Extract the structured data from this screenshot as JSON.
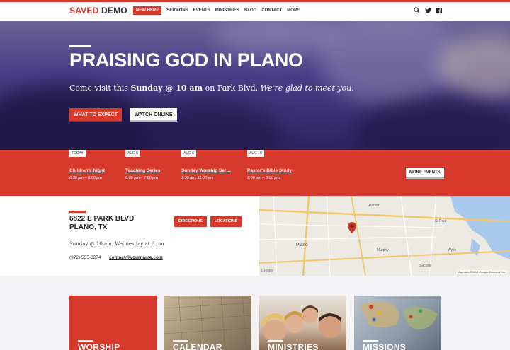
{
  "brand": {
    "part1": "SAVED",
    "part2": "DEMO",
    "accent": "#d7392c"
  },
  "nav": {
    "new_here": "NEW HERE",
    "items": [
      "SERMONS",
      "EVENTS",
      "MINISTRIES",
      "BLOG",
      "CONTACT",
      "MORE"
    ]
  },
  "header_icons": [
    "search-icon",
    "twitter-icon",
    "facebook-icon"
  ],
  "hero": {
    "title": "PRAISING GOD IN PLANO",
    "sub_pre": "Come visit this ",
    "sub_bold": "Sunday @ 10 am",
    "sub_mid": " on Park Blvd. ",
    "sub_italic": "We're glad to meet you.",
    "btn_expect": "WHAT TO EXPECT",
    "btn_watch": "WATCH ONLINE"
  },
  "events": {
    "items": [
      {
        "tag": "TODAY",
        "name": "Children's Night",
        "time": "6:30 pm – 8:00 pm"
      },
      {
        "tag": "AUG 5",
        "name": "Teaching Series",
        "time": "6:00 pm – 7:00 pm"
      },
      {
        "tag": "AUG 6",
        "name": "Sunday Worship Ser…",
        "time": "9:30 am, 11:00 am"
      },
      {
        "tag": "AUG 10",
        "name": "Pastor's Bible Study",
        "time": "7:00 pm – 8:00 pm"
      }
    ],
    "more": "MORE EVENTS"
  },
  "location": {
    "line1": "6822 E PARK BLVD",
    "line2": "PLANO, TX",
    "directions": "DIRECTIONS",
    "locations": "LOCATIONS",
    "times": "Sunday @ 10 am, Wednesday at 6 pm",
    "phone": "(972) 555-6274",
    "email": "contact@yourname.com"
  },
  "map": {
    "labels": {
      "parker": "Parker",
      "stpaul": "St Paul",
      "plano": "Plano",
      "murphy": "Murphy",
      "wylie": "Wylie",
      "sachse": "Sachse"
    },
    "google": "Google",
    "footer": "Map data ©2017 Google   Terms of Use"
  },
  "cards": [
    {
      "label": "WORSHIP",
      "color": "#d7392c"
    },
    {
      "label": "CALENDAR",
      "color": "#a89880"
    },
    {
      "label": "MINISTRIES",
      "color": "#c9b8a6"
    },
    {
      "label": "MISSIONS",
      "color": "#8a97a8"
    }
  ]
}
